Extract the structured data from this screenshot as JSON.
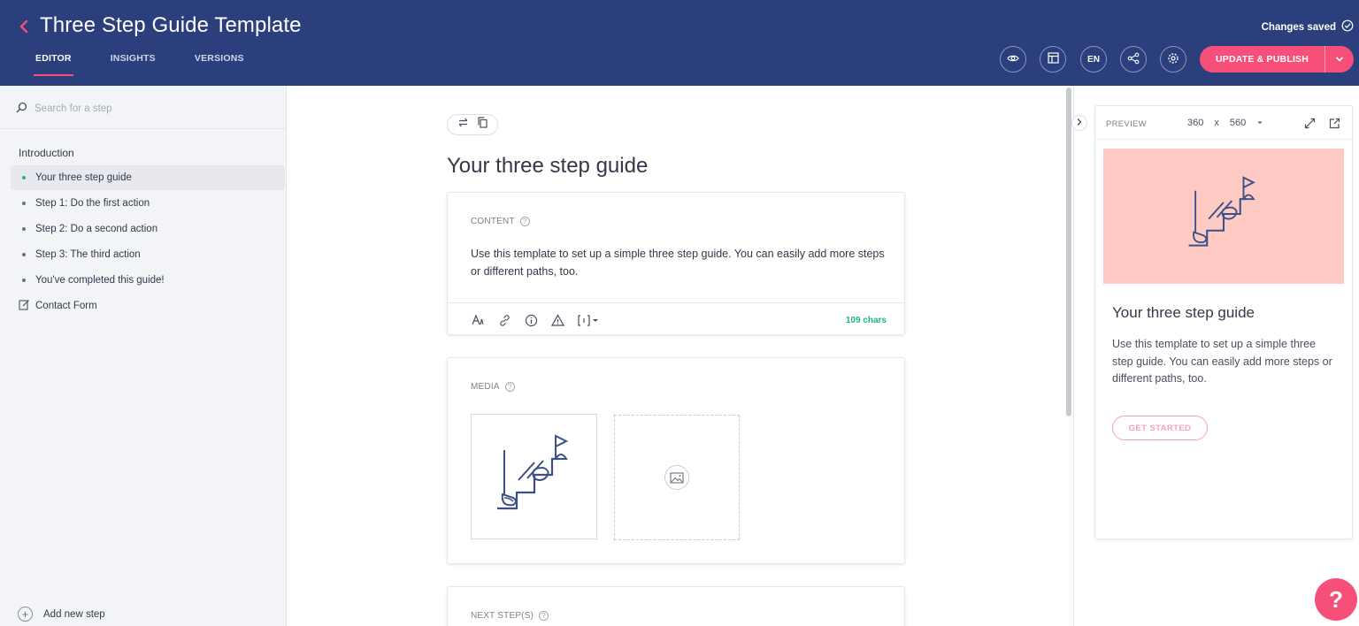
{
  "header": {
    "title": "Three Step Guide Template",
    "tabs": [
      "EDITOR",
      "INSIGHTS",
      "VERSIONS"
    ],
    "status": "Changes saved",
    "language": "EN",
    "publish_label": "UPDATE & PUBLISH",
    "accent_color": "#f6507a",
    "bg_color": "#2a3f7c",
    "icons": [
      "back-arrow-icon",
      "eye-icon",
      "layout-icon",
      "share-icon",
      "gear-icon",
      "chevron-down-icon",
      "check-circle-icon"
    ]
  },
  "sidebar": {
    "search_placeholder": "Search for a step",
    "section": "Introduction",
    "steps": [
      "Your three step guide",
      "Step 1: Do the first action",
      "Step 2: Do a second action",
      "Step 3: The third action",
      "You've completed this guide!"
    ],
    "contact": "Contact Form",
    "add_step": "Add new step"
  },
  "main": {
    "step_title": "Your three step guide",
    "content_label": "CONTENT",
    "content_text": "Use this template to set up a simple three step guide. You can easily add more steps or different paths, too.",
    "chars": "109 chars",
    "media_label": "MEDIA",
    "next_label": "NEXT STEP(S)"
  },
  "preview": {
    "label": "PREVIEW",
    "width": "360",
    "x": "x",
    "height": "560",
    "title": "Your three step guide",
    "text": "Use this template to set up a simple three step guide. You can easily add more steps or different paths, too.",
    "button": "GET STARTED",
    "image_bg": "#fecbc4"
  },
  "help": "?"
}
